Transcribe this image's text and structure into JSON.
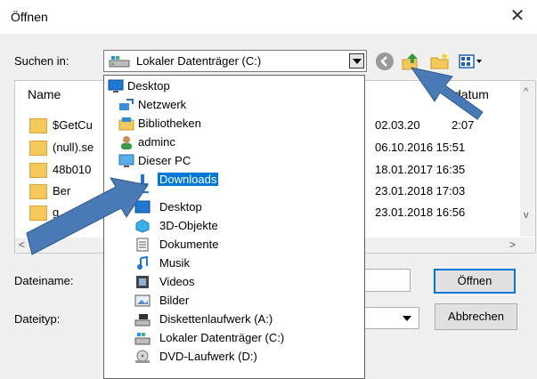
{
  "window": {
    "title": "Öffnen",
    "close_glyph": "✕"
  },
  "lookin": {
    "label": "Suchen in:",
    "value": "Lokaler Datenträger (C:)",
    "icon": "drive-icon"
  },
  "toolbar": {
    "icons": [
      "back-icon",
      "up-folder-icon",
      "new-folder-icon",
      "view-menu-icon"
    ]
  },
  "filelist": {
    "headers": {
      "name": "Name",
      "date": "Änderungsdatum",
      "date_visible": "datum"
    },
    "rows": [
      {
        "name": "$GetCu",
        "date": "02.03.20",
        "time": "2:07"
      },
      {
        "name": "(null).se",
        "date": "06.10.2016 15:51"
      },
      {
        "name": "48b010",
        "date": "18.01.2017 16:35"
      },
      {
        "name": "Ber",
        "date": "23.01.2018 17:03"
      },
      {
        "name": "g",
        "date": "23.01.2018 16:56"
      }
    ]
  },
  "form": {
    "filename_label": "Dateiname:",
    "filetype_label": "Dateityp:",
    "open_button": "Öffnen",
    "cancel_button": "Abbrechen"
  },
  "dropdown": {
    "items": [
      {
        "label": "Desktop",
        "icon": "desktop-icon",
        "indent": 0
      },
      {
        "label": "Netzwerk",
        "icon": "network-icon",
        "indent": 1
      },
      {
        "label": "Bibliotheken",
        "icon": "libraries-icon",
        "indent": 1
      },
      {
        "label": "adminc",
        "icon": "user-icon",
        "indent": 1
      },
      {
        "label": "Dieser PC",
        "icon": "this-pc-icon",
        "indent": 1
      },
      {
        "label": "Downloads",
        "icon": "downloads-icon",
        "indent": 2,
        "selected": true
      },
      {
        "label": "Desktop",
        "icon": "desktop-icon",
        "indent": 2
      },
      {
        "label": "3D-Objekte",
        "icon": "3d-objects-icon",
        "indent": 2
      },
      {
        "label": "Dokumente",
        "icon": "documents-icon",
        "indent": 2
      },
      {
        "label": "Musik",
        "icon": "music-icon",
        "indent": 2
      },
      {
        "label": "Videos",
        "icon": "videos-icon",
        "indent": 2
      },
      {
        "label": "Bilder",
        "icon": "pictures-icon",
        "indent": 2
      },
      {
        "label": "Diskettenlaufwerk (A:)",
        "icon": "floppy-drive-icon",
        "indent": 2
      },
      {
        "label": "Lokaler Datenträger (C:)",
        "icon": "local-disk-icon",
        "indent": 2
      },
      {
        "label": "DVD-Laufwerk (D:)",
        "icon": "dvd-drive-icon",
        "indent": 2
      }
    ]
  },
  "colors": {
    "accent": "#0078d7",
    "arrow": "#4a7ab5",
    "folder": "#f5c85a"
  }
}
